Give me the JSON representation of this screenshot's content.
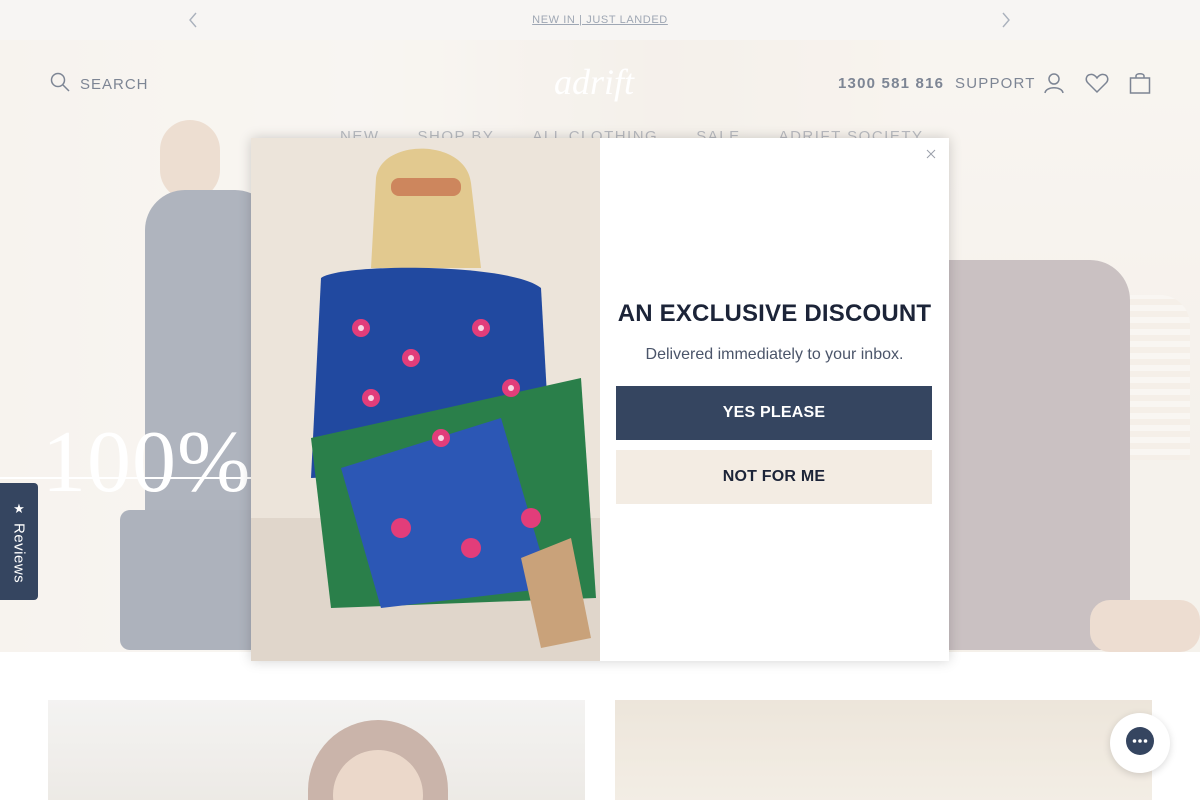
{
  "announcement": {
    "text": "NEW IN | JUST LANDED"
  },
  "header": {
    "search_label": "SEARCH",
    "logo_text": "adrift",
    "phone": "1300 581 816",
    "support": "SUPPORT"
  },
  "nav": {
    "items": [
      "NEW",
      "SHOP BY",
      "ALL CLOTHING",
      "SALE",
      "ADRIFT SOCIETY"
    ]
  },
  "hero": {
    "headline": "100%"
  },
  "reviews_tab": {
    "label": "Reviews"
  },
  "modal": {
    "title": "AN EXCLUSIVE DISCOUNT",
    "subtitle": "Delivered immediately to your inbox.",
    "yes_label": "YES PLEASE",
    "no_label": "NOT FOR ME"
  },
  "colors": {
    "primary": "#354560",
    "secondary_button": "#f3ece3",
    "announcement_bg": "#f4f2ef"
  },
  "icons": [
    "chevron-left-icon",
    "chevron-right-icon",
    "search-icon",
    "account-icon",
    "wishlist-icon",
    "cart-icon",
    "close-icon",
    "star-icon",
    "chat-icon"
  ]
}
